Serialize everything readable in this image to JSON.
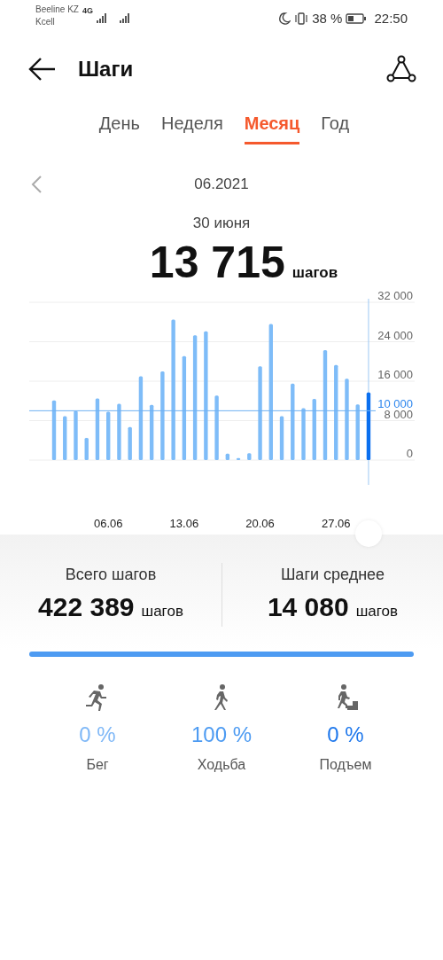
{
  "status_bar": {
    "carrier_1": "Beeline KZ",
    "network_badge": "4G",
    "carrier_2": "Kcell",
    "battery_text": "38 %",
    "time": "22:50"
  },
  "header": {
    "title": "Шаги"
  },
  "tabs": [
    {
      "label": "День",
      "selected": false
    },
    {
      "label": "Неделя",
      "selected": false
    },
    {
      "label": "Месяц",
      "selected": true
    },
    {
      "label": "Год",
      "selected": false
    }
  ],
  "period": {
    "label": "06.2021"
  },
  "selected_day": {
    "date": "30 июня",
    "value": "13 715",
    "unit": "шагов"
  },
  "chart": {
    "bars": [
      {
        "selected": false
      },
      {
        "selected": false
      },
      {
        "selected": false
      },
      {
        "selected": false
      },
      {
        "selected": false
      },
      {
        "selected": false
      },
      {
        "selected": false
      },
      {
        "selected": false
      },
      {
        "selected": false
      },
      {
        "selected": false
      },
      {
        "selected": false
      },
      {
        "selected": false
      },
      {
        "selected": false
      },
      {
        "selected": false
      },
      {
        "selected": false
      },
      {
        "selected": false
      },
      {
        "selected": false
      },
      {
        "selected": false
      },
      {
        "selected": false
      },
      {
        "selected": false
      },
      {
        "selected": false
      },
      {
        "selected": false
      },
      {
        "selected": false
      },
      {
        "selected": false
      },
      {
        "selected": false
      },
      {
        "selected": false
      },
      {
        "selected": false
      },
      {
        "selected": false
      },
      {
        "selected": false
      },
      {
        "selected": true
      }
    ],
    "chart_data": {
      "type": "bar",
      "categories": [
        null,
        null,
        null,
        null,
        null,
        "06.06",
        null,
        null,
        null,
        null,
        null,
        null,
        "13.06",
        null,
        null,
        null,
        null,
        null,
        null,
        "20.06",
        null,
        null,
        null,
        null,
        null,
        null,
        "27.06",
        null,
        null,
        null
      ],
      "values": [
        12100,
        8900,
        10000,
        4500,
        12500,
        9800,
        11400,
        6700,
        17000,
        11200,
        18000,
        28500,
        21100,
        25300,
        26100,
        13100,
        1300,
        400,
        1400,
        19000,
        27600,
        8900,
        15500,
        10500,
        12400,
        22300,
        19300,
        16500,
        11300,
        13700
      ],
      "ylim": [
        0,
        32000
      ],
      "yticks": [
        {
          "value": 0,
          "label": "0"
        },
        {
          "value": 8000,
          "label": "8 000"
        },
        {
          "value": 16000,
          "label": "16 000"
        },
        {
          "value": 24000,
          "label": "24 000"
        },
        {
          "value": 32000,
          "label": "32 000"
        }
      ],
      "grid": true,
      "ref_lines": [
        {
          "axis": "y",
          "value": 10000,
          "label": "10 000"
        }
      ]
    }
  },
  "summary": [
    {
      "label": "Всего шагов",
      "value": "422 389",
      "unit": "шагов"
    },
    {
      "label": "Шаги среднее",
      "value": "14 080",
      "unit": "шагов"
    }
  ],
  "activity_bar": {
    "level": 1
  },
  "activities": [
    {
      "kind": "run",
      "percent": "0 %",
      "label": "Бег",
      "color": "#7fb8f7"
    },
    {
      "kind": "walk",
      "percent": "100 %",
      "label": "Ходьба",
      "color": "#4d9bf2"
    },
    {
      "kind": "climb",
      "percent": "0 %",
      "label": "Подъем",
      "color": "#1f78ec"
    }
  ]
}
